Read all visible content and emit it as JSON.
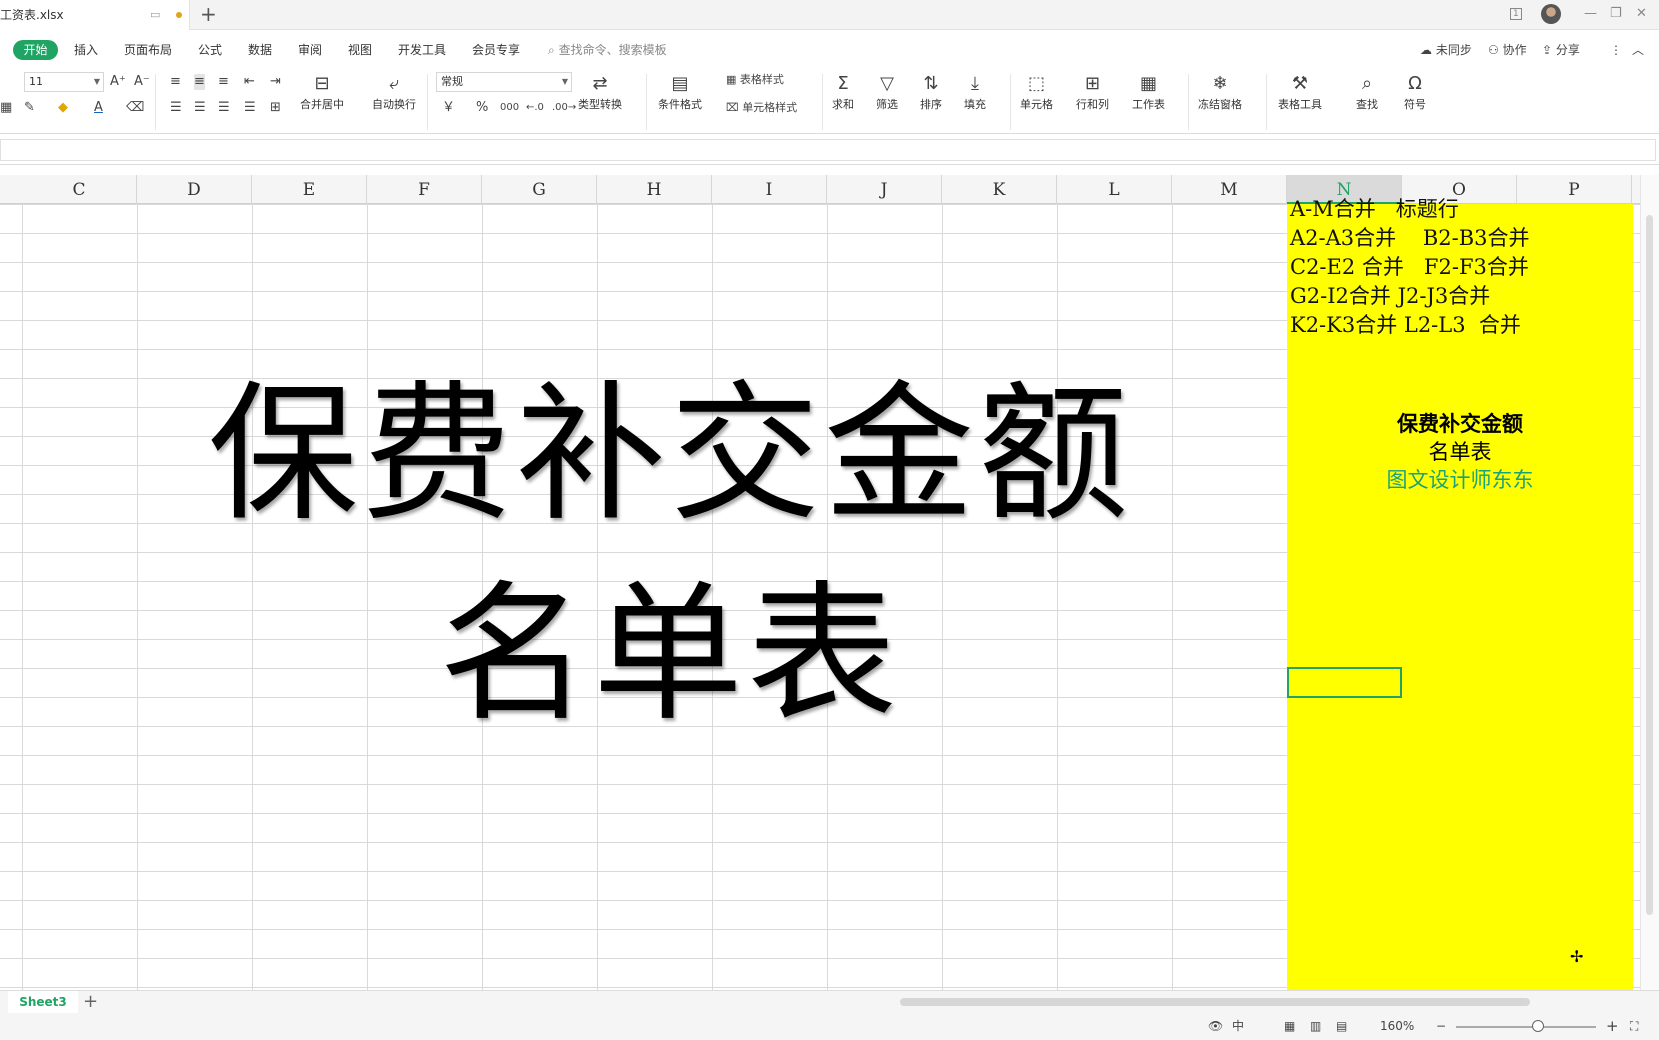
{
  "titlebar": {
    "doc_name": "工资表.xlsx",
    "new_tab": "+",
    "minimize": "—",
    "restore": "❐",
    "close": "✕"
  },
  "menu": {
    "tabs": [
      "开始",
      "插入",
      "页面布局",
      "公式",
      "数据",
      "审阅",
      "视图",
      "开发工具",
      "会员专享"
    ],
    "search_placeholder": "查找命令、搜索模板",
    "sync": "未同步",
    "collab": "协作",
    "share": "分享"
  },
  "ribbon": {
    "font_size": "11",
    "number_format": "常规",
    "merge_center": "合并居中",
    "wrap_text": "自动换行",
    "type_convert": "类型转换",
    "conditional_format": "条件格式",
    "table_style": "表格样式",
    "cell_style": "单元格样式",
    "sum": "求和",
    "filter": "筛选",
    "sort": "排序",
    "fill": "填充",
    "cell": "单元格",
    "row_col": "行和列",
    "worksheet": "工作表",
    "freeze": "冻结窗格",
    "table_tools": "表格工具",
    "find": "查找",
    "symbol": "符号",
    "currency": "￥",
    "percent": "%",
    "thousands": "000",
    "inc_decimal": "←.0",
    "dec_decimal": ".00→"
  },
  "columns": [
    {
      "label": "C"
    },
    {
      "label": "D"
    },
    {
      "label": "E"
    },
    {
      "label": "F"
    },
    {
      "label": "G"
    },
    {
      "label": "H"
    },
    {
      "label": "I"
    },
    {
      "label": "J"
    },
    {
      "label": "K"
    },
    {
      "label": "L"
    },
    {
      "label": "M"
    },
    {
      "label": "N",
      "active": true
    },
    {
      "label": "O"
    },
    {
      "label": "P"
    }
  ],
  "content": {
    "title_line1": "保费补交金额",
    "title_line2": "名单表",
    "notes": [
      "A-M合并   标题行",
      "A2-A3合并    B2-B3合并",
      "C2-E2 合并   F2-F3合并",
      "G2-I2合并 J2-J3合并",
      "K2-K3合并 L2-L3  合并"
    ],
    "yellow_title1": "保费补交金额",
    "yellow_title2": "名单表",
    "designer": "图文设计师东东",
    "designer_color": "#1aa37a",
    "highlight_color": "#ffff00"
  },
  "sheets": {
    "active": "Sheet3",
    "add": "+"
  },
  "status": {
    "zoom": "160%",
    "zoom_minus": "−",
    "zoom_plus": "+"
  },
  "accent_color": "#1fa463"
}
